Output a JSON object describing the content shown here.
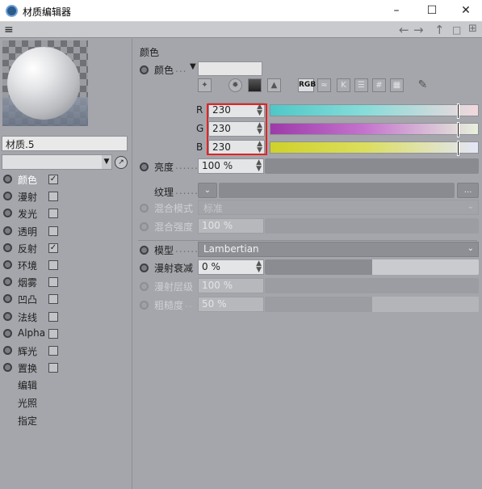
{
  "window": {
    "title": "材质编辑器",
    "controls": [
      "–",
      "☐",
      "✕"
    ]
  },
  "toolbar": {
    "menu_icon": "≡",
    "back": "←",
    "forward": "→",
    "up": "↑",
    "lock": "🔒",
    "new_window": "⊞"
  },
  "material": {
    "name": "材质.5"
  },
  "channels": [
    {
      "label": "颜色",
      "checked": true,
      "selected": true
    },
    {
      "label": "漫射",
      "checked": false
    },
    {
      "label": "发光",
      "checked": false
    },
    {
      "label": "透明",
      "checked": false
    },
    {
      "label": "反射",
      "checked": true
    },
    {
      "label": "环境",
      "checked": false
    },
    {
      "label": "烟雾",
      "checked": false
    },
    {
      "label": "凹凸",
      "checked": false
    },
    {
      "label": "法线",
      "checked": false
    },
    {
      "label": "Alpha",
      "checked": false
    },
    {
      "label": "辉光",
      "checked": false
    },
    {
      "label": "置换",
      "checked": false
    }
  ],
  "extra_items": [
    "编辑",
    "光照",
    "指定"
  ],
  "check_mark": "✓",
  "color_section": {
    "title": "颜色",
    "color_label": "颜色",
    "color_value": "#e6e6e6",
    "mode_buttons": [
      "RGB"
    ],
    "r": {
      "letter": "R",
      "value": "230",
      "fraction": 0.9
    },
    "g": {
      "letter": "G",
      "value": "230",
      "fraction": 0.9
    },
    "b": {
      "letter": "B",
      "value": "230",
      "fraction": 0.9
    }
  },
  "brightness": {
    "label": "亮度",
    "value": "100 %"
  },
  "texture": {
    "label": "纹理",
    "more": "..."
  },
  "blend_mode": {
    "label": "混合模式",
    "value": "标准"
  },
  "blend_strength": {
    "label": "混合强度",
    "value": "100 %"
  },
  "model": {
    "label": "模型",
    "value": "Lambertian"
  },
  "diffuse_falloff": {
    "label": "漫射衰减",
    "value": "0 %",
    "fraction": 0.5
  },
  "diffuse_level": {
    "label": "漫射层级",
    "value": "100 %"
  },
  "roughness": {
    "label": "粗糙度",
    "value": "50 %",
    "fraction": 0.5
  }
}
